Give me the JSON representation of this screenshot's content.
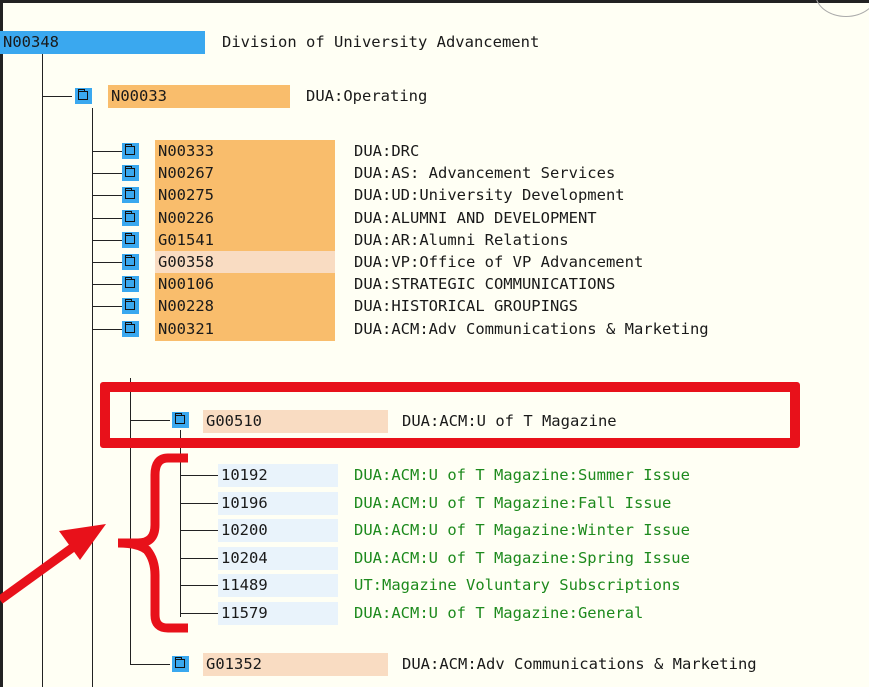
{
  "root": {
    "code": "N00348",
    "label": "Division of University Advancement"
  },
  "operating": {
    "code": "N00033",
    "label": "DUA:Operating"
  },
  "children": [
    {
      "code": "N00333",
      "label": "DUA:DRC",
      "color": "orange"
    },
    {
      "code": "N00267",
      "label": "DUA:AS: Advancement Services",
      "color": "orange"
    },
    {
      "code": "N00275",
      "label": "DUA:UD:University Development",
      "color": "orange"
    },
    {
      "code": "N00226",
      "label": "DUA:ALUMNI AND DEVELOPMENT",
      "color": "orange"
    },
    {
      "code": "G01541",
      "label": "DUA:AR:Alumni Relations",
      "color": "orange"
    },
    {
      "code": "G00358",
      "label": "DUA:VP:Office of VP Advancement",
      "color": "peach"
    },
    {
      "code": "N00106",
      "label": "DUA:STRATEGIC COMMUNICATIONS",
      "color": "orange"
    },
    {
      "code": "N00228",
      "label": "DUA:HISTORICAL GROUPINGS",
      "color": "orange"
    },
    {
      "code": "N00321",
      "label": "DUA:ACM:Adv Communications & Marketing",
      "color": "orange"
    }
  ],
  "magazine": {
    "code": "G00510",
    "label": "DUA:ACM:U of T Magazine"
  },
  "issues": [
    {
      "code": "10192",
      "label": "DUA:ACM:U of T Magazine:Summer Issue"
    },
    {
      "code": "10196",
      "label": "DUA:ACM:U of T Magazine:Fall Issue"
    },
    {
      "code": "10200",
      "label": "DUA:ACM:U of T Magazine:Winter Issue"
    },
    {
      "code": "10204",
      "label": "DUA:ACM:U of T Magazine:Spring Issue"
    },
    {
      "code": "11489",
      "label": "UT:Magazine Voluntary Subscriptions"
    },
    {
      "code": "11579",
      "label": "DUA:ACM:U of T Magazine:General"
    }
  ],
  "last": {
    "code": "G01352",
    "label": "DUA:ACM:Adv Communications & Marketing"
  },
  "colors": {
    "blue": "#3aa8ef",
    "orange": "#f9bd6c",
    "peach": "#f9dcc2",
    "light": "#e9f3fb",
    "green": "#1d8a1d",
    "red": "#e8111a"
  }
}
